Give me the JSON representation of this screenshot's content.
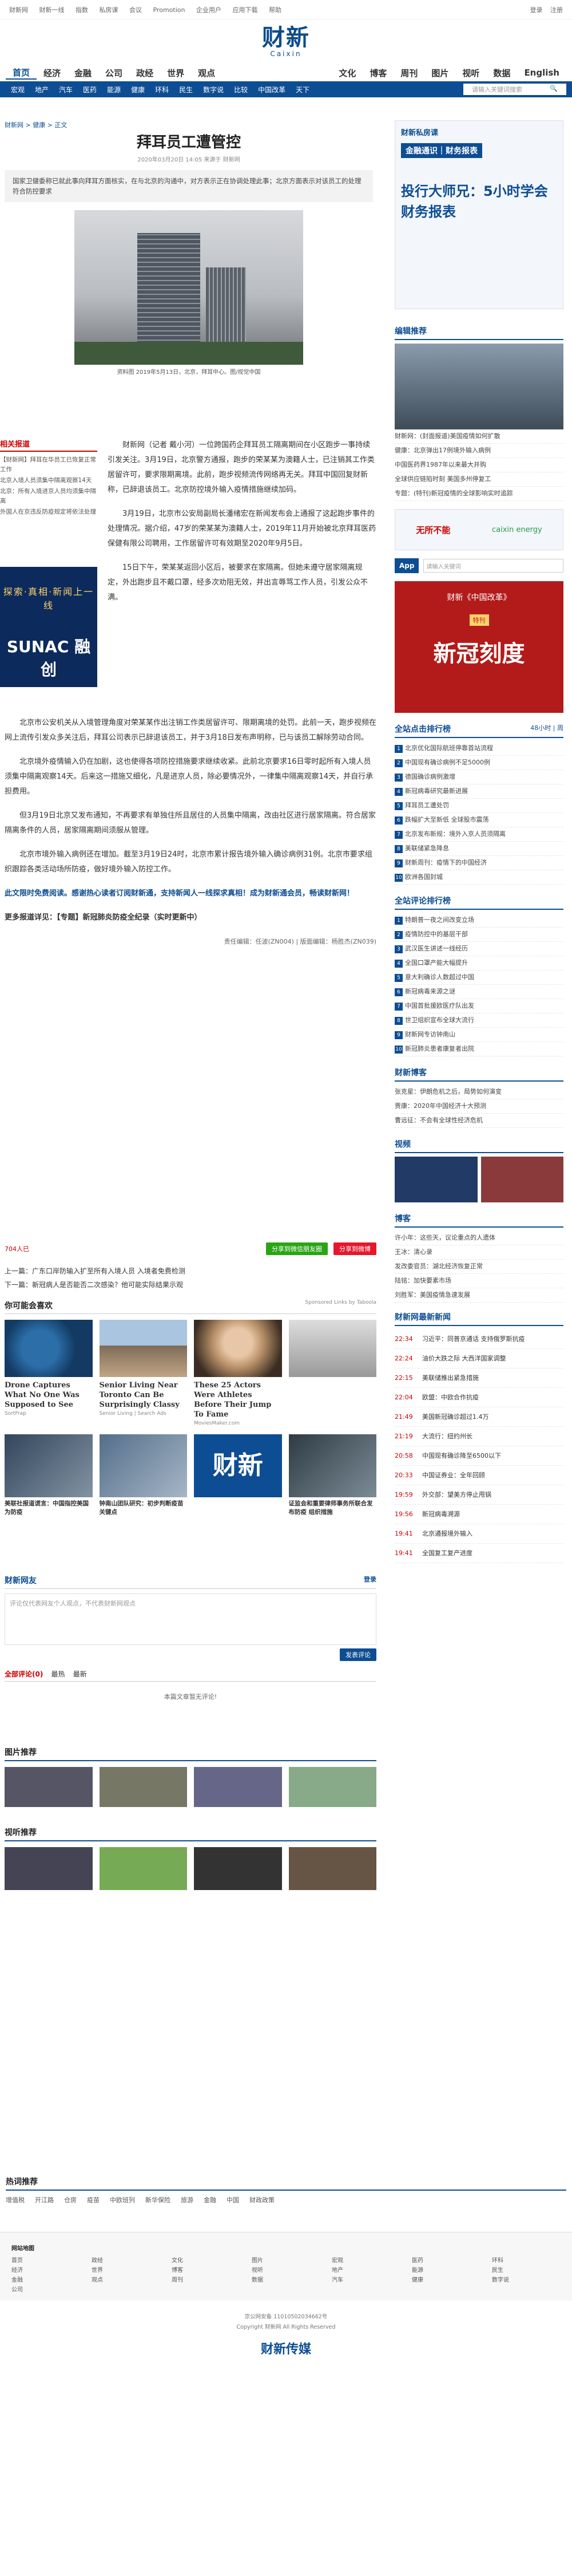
{
  "topbar": {
    "links": [
      "财新网",
      "财新一线",
      "指数",
      "私房课",
      "会议",
      "Promotion",
      "企业用户",
      "应用下载",
      "帮助"
    ],
    "search": "搜索",
    "login": "登录",
    "register": "注册"
  },
  "logo": {
    "cn": "财新",
    "en": "Caixin"
  },
  "nav1": [
    "首页",
    "经济",
    "金融",
    "公司",
    "政经",
    "世界",
    "观点",
    "文化",
    "博客",
    "周刊",
    "图片",
    "视听",
    "数据",
    "English"
  ],
  "nav2": [
    "宏观",
    "地产",
    "汽车",
    "医药",
    "能源",
    "健康",
    "环科",
    "民生",
    "数字说",
    "比较",
    "中国改革",
    "天下"
  ],
  "nav_search_placeholder": "请输入关键词搜索",
  "breadcrumb": "财新网 > 健康 > 正文",
  "title": "拜耳员工遭管控",
  "meta": "2020年03月20日 14:05 来源于 财新网",
  "summary": "国家卫健委称已就此事向拜耳方面核实，在与北京的沟通中，对方表示正在协调处理此事；北京方面表示对该员工的处理符合防控要求",
  "photo_caption": "资料图 2019年5月13日，北京，拜耳中心。图/视觉中国",
  "related": {
    "title": "相关报道",
    "items": [
      "【财新网】拜耳在华员工已恢复正常工作",
      "北京入境人员须集中隔离观察14天",
      "北京：所有入境进京人员均须集中隔离",
      "外国人在京违反防疫规定将依法处理"
    ]
  },
  "ad_left": {
    "line1": "探索·真相·新闻上一线",
    "brand": "SUNAC 融创"
  },
  "para1": "财新网（记者 戴小河）一位跨国药企拜耳员工隔离期间在小区跑步一事持续引发关注。3月19日，北京警方通报，跑步的荣某某为澳籍人士，已注销其工作类居留许可，要求限期离境。此前，跑步视频流传网络再无关。拜耳中国回复财新称，已辞退该员工。北京防控境外输入疫情措施继续加码。",
  "para2": "3月19日，北京市公安局副局长潘绪宏在新闻发布会上通报了这起跑步事件的处理情况。据介绍，47岁的荣某某为澳籍人士，2019年11月开始被北京拜耳医药保健有限公司聘用，工作居留许可有效期至2020年9月5日。",
  "para3": "15日下午，荣某某返回小区后，被要求在家隔离。但她未遵守居家隔离规定，外出跑步且不戴口罩，经多次劝阻无效，并出言辱骂工作人员，引发公众不满。",
  "para4": "北京市公安机关从入境管理角度对荣某某作出注销工作类居留许可、限期离境的处罚。此前一天，跑步视频在网上流传引发众多关注后，拜耳公司表示已辞退该员工，并于3月18日发布声明称，已与该员工解除劳动合同。",
  "para5": "北京境外疫情输入仍在加剧，这也使得各项防控措施要求继续收紧。此前北京要求16日零时起所有入境人员须集中隔离观察14天。后来这一措施又细化，凡是进京人员，除必要情况外，一律集中隔离观察14天，并自行承担费用。",
  "para6": "但3月19日北京又发布通知，不再要求有单独住所且居住的人员集中隔离，改由社区进行居家隔离。符合居家隔离条件的人员，居家隔离期间须服从管理。",
  "para7": "北京市境外输入病例还在增加。截至3月19日24时，北京市累计报告境外输入确诊病例31例。北京市要求组织跟踪各类活动场所防疫，做好境外输入防控工作。",
  "promo_line": "此文限时免费阅读。感谢热心读者订阅财新通，支持新闻人一线探求真相！成为财新通会员，畅读财新网！",
  "more_reading": "更多报道详见：【专题】新冠肺炎防疫全纪录（实时更新中）",
  "editor": "责任编辑：任波(ZN004) | 版面编辑：杨胜杰(ZN039)",
  "share": {
    "wechat": "分享到微信朋友圈",
    "weibo": "分享到微博",
    "count": "704人已"
  },
  "prev": "上一篇：广东口岸防输入扩至所有入境人员 入境者免费检测",
  "next": "下一篇：新冠病人是否能否二次感染？他可能实际结果示观",
  "you_may_like": "你可能会喜欢",
  "sponsored": "Sponsored Links by Taboola",
  "cards": [
    {
      "t": "Drone Captures What No One Was Supposed to See",
      "s": "SortFrap"
    },
    {
      "t": "Senior Living Near Toronto Can Be Surprisingly Classy",
      "s": "Senior Living | Search Ads"
    },
    {
      "t": "These 25 Actors Were Athletes Before Their Jump To Fame",
      "s": "MoviesMaker.com"
    },
    {
      "t": "",
      "s": ""
    }
  ],
  "cards2": [
    {
      "t": "美联社报道谎言：中国指控美国为防疫"
    },
    {
      "t": "钟南山团队研究：初步判断疫苗关键点"
    },
    {
      "t": "财新"
    },
    {
      "t": "证监会和重要律师事务所联合发布防疫 组织措施"
    }
  ],
  "comment": {
    "title": "财新网友",
    "placeholder": "评论仅代表网友个人观点，不代表财新网观点",
    "login": "登录",
    "submit": "发表评论",
    "all": "全部评论(0)",
    "tabs": [
      "最热",
      "最新"
    ],
    "empty": "本篇文章暂无评论!"
  },
  "gallery_title": "图片推荐",
  "video_title": "视听推荐",
  "side": {
    "ad1": {
      "title": "财新私房课",
      "sub": "金融通识｜财务报表",
      "big": "投行大师兄：5小时学会财务报表"
    },
    "editor_pick_title": "编辑推荐",
    "editor_picks": [
      "财新网：(封面报道)美国疫情如何扩散",
      "健康：北京弹出17例境外输入病例",
      "中国医药界1987年以来最大并购",
      "全球供应链陷时刻 美国多州停复工",
      "专题：(特刊)新冠疫情的全球影响实时追踪"
    ],
    "ad2": {
      "brand": "无所不能",
      "partner": "caixin energy"
    },
    "app": {
      "label": "App",
      "search": "请输入关键词"
    },
    "ad3": {
      "title": "财新《中国改革》",
      "big": "新冠刻度",
      "tag": "特刊"
    },
    "rank_title": "全站点击排行榜",
    "rank_tabs": [
      "48小时",
      "周"
    ],
    "rank": [
      "北京优化国际航班停靠首站流程",
      "中国现有确诊病例不足5000例",
      "德国确诊病例激增",
      "新冠病毒研究最新进展",
      "拜耳员工遭处罚",
      "跌幅扩大至新低 全球股市震荡",
      "北京发布新规：境外入京人员须隔离",
      "美联储紧急降息",
      "财新周刊：疫情下的中国经济",
      "欧洲各国封城"
    ],
    "comment_rank_title": "全站评论排行榜",
    "comment_rank": [
      "特朗普一夜之间改变立场",
      "疫情防控中的基层干部",
      "武汉医生讲述一线经历",
      "全国口罩产能大幅提升",
      "意大利确诊人数超过中国",
      "新冠病毒来源之谜",
      "中国首批援欧医疗队出发",
      "世卫组织宣布全球大流行",
      "财新网专访钟南山",
      "新冠肺炎患者康复者出院"
    ],
    "blog_hot_title": "财新博客",
    "blog_hot": [
      "张克星：伊朗危机之后，局势如何演变",
      "贾康：2020年中国经济十大预测",
      "曹远征：不会有全球性经济危机"
    ],
    "video_title": "视频",
    "blog_title": "博客",
    "blogs": [
      "许小年：这些天，议论重点的人遗体",
      "王冰：清心录",
      "发改委官员：湖北经济恢复正常",
      "陆铭：加快要素市场",
      "刘胜军：美国疫情急速发展"
    ],
    "news_title": "财新网最新新闻",
    "news": [
      {
        "time": "22:34",
        "t": "习近平：同普京通话 支持俄罗斯抗疫"
      },
      {
        "time": "22:24",
        "t": "油价大跌之际 大西洋国家调整"
      },
      {
        "time": "22:15",
        "t": "美联储推出紧急措施"
      },
      {
        "time": "22:04",
        "t": "欧盟：中欧合作抗疫"
      },
      {
        "time": "21:49",
        "t": "美国新冠确诊超过1.4万"
      },
      {
        "time": "21:19",
        "t": "大流行：纽约州长"
      },
      {
        "time": "20:58",
        "t": "中国现有确诊降至6500以下"
      },
      {
        "time": "20:33",
        "t": "中国证券业：全年回顾"
      },
      {
        "time": "19:59",
        "t": "外交部：望美方停止甩锅"
      },
      {
        "time": "19:56",
        "t": "新冠病毒溯源"
      },
      {
        "time": "19:41",
        "t": "北京通报境外输入"
      },
      {
        "time": "19:41",
        "t": "全国复工复产进度"
      }
    ]
  },
  "hotwords_title": "热词推荐",
  "hotwords": [
    "增值税",
    "开江路",
    "仓房",
    "疫苗",
    "中欧班列",
    "新华保险",
    "旅游",
    "金融",
    "中国",
    "财政政策",
    "",
    "",
    "",
    "",
    "",
    "",
    ""
  ],
  "sitemap_title": "网站地图",
  "copyright": [
    "京公网安备 11010502034662号",
    "Copyright 财新网 All Rights Reserved"
  ],
  "footer_logo": "财新传媒"
}
